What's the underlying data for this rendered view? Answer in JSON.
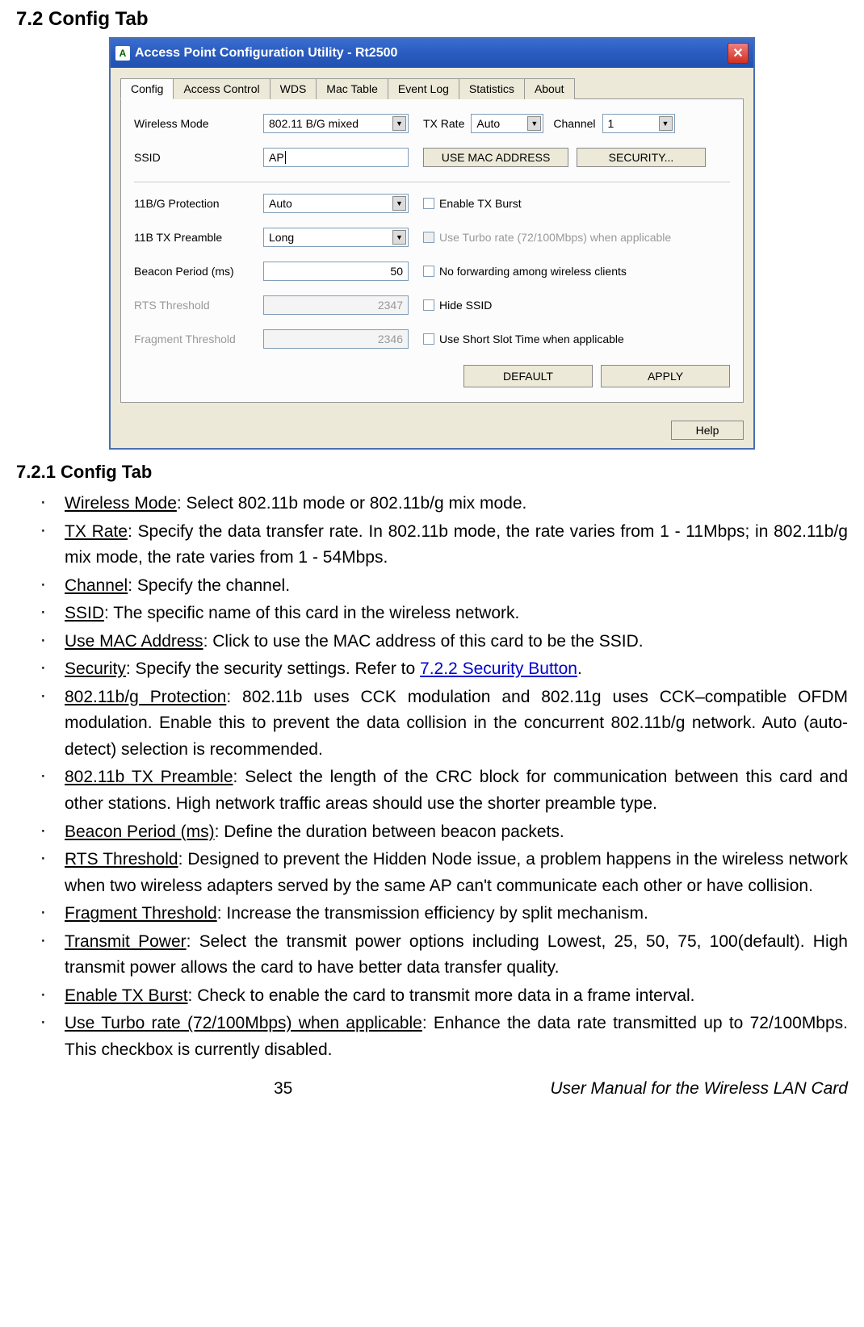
{
  "headings": {
    "h72": "7.2 Config Tab",
    "h721": "7.2.1 Config Tab"
  },
  "window": {
    "title": "Access Point Configuration Utility - Rt2500",
    "tabs": [
      "Config",
      "Access Control",
      "WDS",
      "Mac Table",
      "Event Log",
      "Statistics",
      "About"
    ],
    "labels": {
      "wireless_mode": "Wireless Mode",
      "tx_rate": "TX Rate",
      "channel": "Channel",
      "ssid": "SSID",
      "protection": "11B/G Protection",
      "preamble": "11B TX Preamble",
      "beacon": "Beacon Period (ms)",
      "rts": "RTS Threshold",
      "fragment": "Fragment Threshold"
    },
    "values": {
      "wireless_mode": "802.11 B/G mixed",
      "tx_rate": "Auto",
      "channel": "1",
      "ssid": "AP",
      "protection": "Auto",
      "preamble": "Long",
      "beacon": "50",
      "rts": "2347",
      "fragment": "2346"
    },
    "checkboxes": {
      "tx_burst": "Enable TX Burst",
      "turbo": "Use Turbo rate (72/100Mbps)  when applicable",
      "no_forward": "No forwarding among wireless clients",
      "hide_ssid": "Hide SSID",
      "short_slot": "Use Short Slot Time when applicable"
    },
    "buttons": {
      "use_mac": "USE MAC ADDRESS",
      "security": "SECURITY...",
      "default": "DEFAULT",
      "apply": "APPLY",
      "help": "Help"
    }
  },
  "list": [
    {
      "term": "Wireless Mode",
      "text": ": Select 802.11b mode or 802.11b/g mix mode."
    },
    {
      "term": "TX Rate",
      "text": ": Specify the data transfer rate. In 802.11b mode, the rate varies from 1 - 11Mbps; in 802.11b/g mix mode, the rate varies from 1 - 54Mbps."
    },
    {
      "term": "Channel",
      "text": ": Specify the channel."
    },
    {
      "term": "SSID",
      "text": ": The specific name of this card in the wireless network."
    },
    {
      "term": "Use MAC Address",
      "text": ": Click to use the MAC address of this card to be the SSID."
    },
    {
      "term": "Security",
      "text_pre": ": Specify the security settings. Refer to ",
      "link": "7.2.2 Security Button",
      "text_post": "."
    },
    {
      "term": "802.11b/g Protection",
      "text": ": 802.11b uses CCK modulation and 802.11g uses CCK–compatible OFDM modulation. Enable this to prevent the data collision in the concurrent 802.11b/g network. Auto (auto-detect) selection is recommended."
    },
    {
      "term": "802.11b TX Preamble",
      "text": ": Select the length of the CRC block for communication between this card and other stations. High network traffic areas should use the shorter preamble type."
    },
    {
      "term": "Beacon Period (ms)",
      "text": ": Define the duration between beacon packets."
    },
    {
      "term": "RTS Threshold",
      "text": ": Designed to prevent the Hidden Node issue, a problem happens in the wireless network when two wireless adapters served by the same AP can't communicate each other or have collision."
    },
    {
      "term": "Fragment Threshold",
      "text": ": Increase the transmission efficiency by split mechanism."
    },
    {
      "term": "Transmit Power",
      "text": ": Select the transmit power options including Lowest, 25, 50, 75, 100(default). High transmit power allows the card to have better data transfer quality."
    },
    {
      "term": "Enable TX Burst",
      "text": ": Check to enable the card to transmit more data in a frame interval."
    },
    {
      "term": "Use Turbo rate (72/100Mbps) when applicable",
      "text": ": Enhance the data rate transmitted up to 72/100Mbps. This checkbox is currently disabled."
    }
  ],
  "footer": {
    "page": "35",
    "title": "User Manual for the Wireless LAN Card"
  }
}
